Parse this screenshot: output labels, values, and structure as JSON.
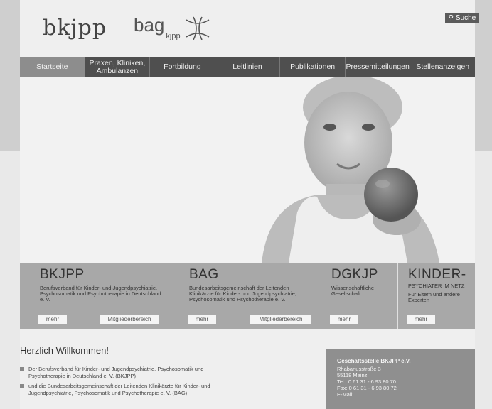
{
  "header": {
    "logo_main": "bkjpp",
    "logo_bag": "bag",
    "logo_bag_sub": "kjpp",
    "search_label": "Suche"
  },
  "nav": {
    "items": [
      {
        "label": "Startseite",
        "active": true
      },
      {
        "label": "Praxen, Kliniken, Ambulanzen",
        "active": false
      },
      {
        "label": "Fortbildung",
        "active": false
      },
      {
        "label": "Leitlinien",
        "active": false
      },
      {
        "label": "Publikationen",
        "active": false
      },
      {
        "label": "Pressemitteilungen",
        "active": false
      },
      {
        "label": "Stellenanzeigen",
        "active": false
      }
    ]
  },
  "cards": [
    {
      "title": "BKJPP",
      "text": "Berufsverband für Kinder- und Jugendpsychiatrie, Psychosomatik und Psychotherapie in Deutschland e. V.",
      "btn1": "mehr",
      "btn2": "Mitgliederbereich"
    },
    {
      "title": "BAG",
      "text": "Bundesarbeitsgemeinschaft der Leitenden Klinikärzte für Kinder- und Jugendpsychiatrie, Psychosomatik und Psychotherapie e. V.",
      "btn1": "mehr",
      "btn2": "Mitgliederbereich"
    },
    {
      "title": "DGKJP",
      "text": "Wissenschaftliche Gesellschaft",
      "btn1": "mehr"
    },
    {
      "title": "KINDER-",
      "subtitle": "PSYCHIATER IM NETZ",
      "text": "Für Eltern und andere Experten",
      "btn1": "mehr"
    }
  ],
  "welcome": {
    "title": "Herzlich Willkommen!",
    "items": [
      "Der Berufsverband für Kinder- und Jugendpsychiatrie, Psychosomatik und Psychotherapie in Deutschland e. V. (BKJPP)",
      "und die Bundesarbeitsgemeinschaft der Leitenden Klinikärzte für Kinder- und Jugendpsychiatrie, Psychosomatik und Psychotherapie e. V. (BAG)"
    ]
  },
  "geschaeftsstelle": {
    "title": "Geschäftsstelle BKJPP e.V.",
    "street": "Rhabanusstraße 3",
    "city": "55118 Mainz",
    "tel": "Tel.: 0 61 31 - 6 93 80 70",
    "fax": "Fax: 0 61 31 - 6 93 80 72",
    "email_label": "E-Mail:"
  },
  "colors": {
    "nav_bg": "#4f4f4f",
    "nav_active": "#8d8d8d",
    "card_bg": "#a8a8a8",
    "info_bg": "#8f8f8f"
  }
}
